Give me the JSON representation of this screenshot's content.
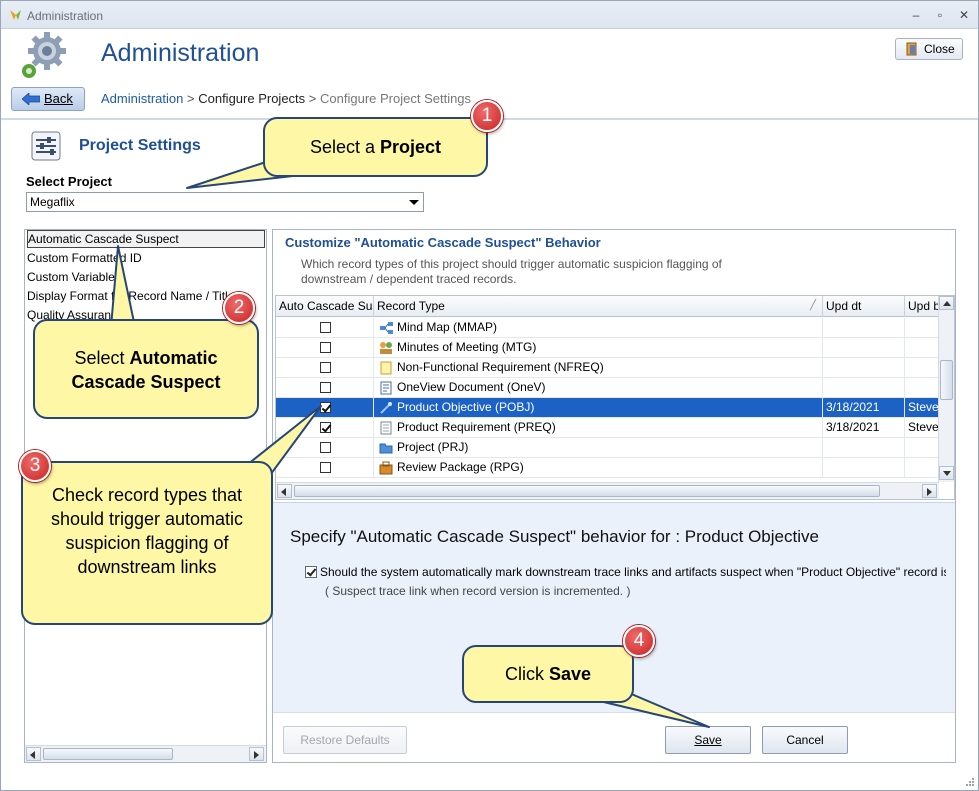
{
  "window": {
    "title": "Administration"
  },
  "header": {
    "title": "Administration",
    "close_label": "Close"
  },
  "nav": {
    "back_label": "Back",
    "breadcrumb": [
      "Administration",
      "Configure Projects",
      "Configure Project Settings"
    ],
    "separator": ">"
  },
  "project_settings": {
    "title": "Project Settings",
    "select_label": "Select Project",
    "selected_project": "Megaflix"
  },
  "left_list": {
    "items": [
      "Automatic Cascade Suspect",
      "Custom Formatted ID",
      "Custom Variables",
      "Display Format for Record Name / Title",
      "Quality Assurance"
    ],
    "selected_index": 0
  },
  "right_panel": {
    "title": "Customize \"Automatic Cascade Suspect\" Behavior",
    "description": "Which record types of this project should trigger automatic suspicion flagging of downstream / dependent traced records.",
    "columns": [
      "Auto Cascade Suspect",
      "Record Type",
      "Upd dt",
      "Upd by"
    ],
    "rows": [
      {
        "checked": false,
        "type": "Mind Map (MMAP)",
        "icon": "mind-map-icon",
        "upd_dt": "",
        "upd_by": "",
        "selected": false
      },
      {
        "checked": false,
        "type": "Minutes of Meeting (MTG)",
        "icon": "meeting-icon",
        "upd_dt": "",
        "upd_by": "",
        "selected": false
      },
      {
        "checked": false,
        "type": "Non-Functional Requirement (NFREQ)",
        "icon": "note-icon",
        "upd_dt": "",
        "upd_by": "",
        "selected": false
      },
      {
        "checked": false,
        "type": "OneView Document (OneV)",
        "icon": "document-icon",
        "upd_dt": "",
        "upd_by": "",
        "selected": false
      },
      {
        "checked": true,
        "type": "Product Objective (POBJ)",
        "icon": "objective-icon",
        "upd_dt": "3/18/2021",
        "upd_by": "Steve",
        "selected": true
      },
      {
        "checked": true,
        "type": "Product Requirement (PREQ)",
        "icon": "requirement-icon",
        "upd_dt": "3/18/2021",
        "upd_by": "Steve",
        "selected": false
      },
      {
        "checked": false,
        "type": "Project (PRJ)",
        "icon": "folder-icon",
        "upd_dt": "",
        "upd_by": "",
        "selected": false
      },
      {
        "checked": false,
        "type": "Review Package (RPG)",
        "icon": "package-icon",
        "upd_dt": "",
        "upd_by": "",
        "selected": false
      }
    ]
  },
  "spec": {
    "title": "Specify \"Automatic Cascade Suspect\" behavior for : Product Objective",
    "checkbox_label": "Should the system automatically mark downstream trace links and artifacts suspect when \"Product Objective\" record is changed?",
    "note": "( Suspect trace link when record version is incremented. )"
  },
  "buttons": {
    "restore": "Restore Defaults",
    "save": "Save",
    "cancel": "Cancel"
  },
  "callouts": {
    "c1": {
      "number": "1",
      "text_before": "Select a ",
      "text_bold": "Project"
    },
    "c2": {
      "number": "2",
      "text_before": "Select ",
      "text_bold": "Automatic Cascade Suspect"
    },
    "c3": {
      "number": "3",
      "text": "Check record types that should trigger automatic suspicion flagging of downstream links"
    },
    "c4": {
      "number": "4",
      "text_before": "Click ",
      "text_bold": "Save"
    }
  },
  "colors": {
    "accent": "#1f4f96",
    "selection": "#1c61c4",
    "callout_fill": "#fdf7a6",
    "badge": "#d32f2f"
  }
}
